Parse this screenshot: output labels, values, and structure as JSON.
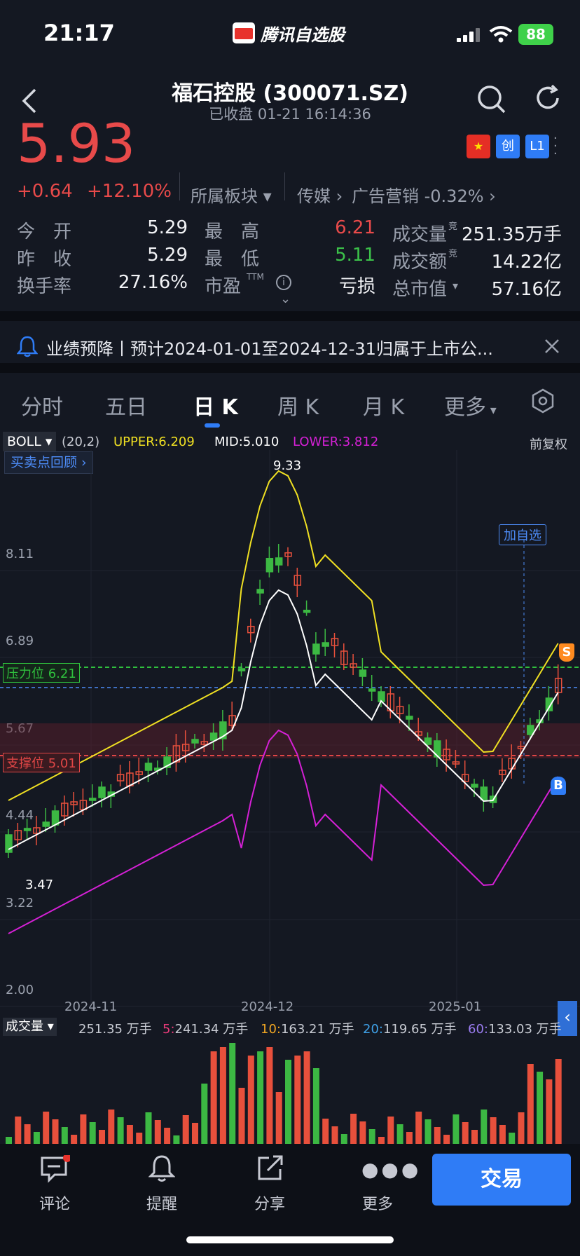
{
  "status_bar": {
    "time": "21:17",
    "app_name": "腾讯自选股",
    "battery": "88"
  },
  "header": {
    "title": "福石控股 (300071.SZ)",
    "subtitle": "已收盘  01-21 16:14:36"
  },
  "quote": {
    "price": "5.93",
    "change": "+0.64",
    "change_pct": "+12.10%",
    "sector_label": "所属板块",
    "sector_1": "传媒",
    "sector_2": "广告营销 -0.32%",
    "tag_chuang": "创",
    "tag_l1": "L1"
  },
  "stats": [
    {
      "label": "今　开",
      "value": "5.29",
      "label2": "最　高",
      "value2": "6.21",
      "label3": "成交量",
      "sup3": "竞",
      "value3": "251.35万手"
    },
    {
      "label": "昨　收",
      "value": "5.29",
      "label2": "最　低",
      "value2": "5.11",
      "label3": "成交额",
      "sup3": "竞",
      "value3": "14.22亿"
    },
    {
      "label": "换手率",
      "value": "27.16%",
      "label2": "市盈",
      "sup2": "TTM",
      "value2": "亏损",
      "label3": "总市值",
      "value3": "57.16亿"
    }
  ],
  "notice": {
    "text": "业绩预降丨预计2024-01-01至2024-12-31归属于上市公..."
  },
  "tabs": [
    "分时",
    "五日",
    "日 K",
    "周 K",
    "月 K",
    "更多"
  ],
  "indicator": {
    "name": "BOLL",
    "params": "(20,2)",
    "upper_label": "UPPER:",
    "upper": "6.209",
    "mid_label": "MID:",
    "mid": "5.010",
    "lower_label": "LOWER:",
    "lower": "3.812",
    "adjust": "前复权",
    "review_btn": "买卖点回顾"
  },
  "price_axis": [
    "8.11",
    "6.89",
    "5.67",
    "4.44",
    "3.22",
    "2.00"
  ],
  "marks": {
    "high_label": "9.33",
    "low_label": "3.47",
    "add_watch": "加自选",
    "resistance": "压力位 6.21",
    "support": "支撑位 5.01",
    "sell_marker": "S",
    "buy_marker": "B"
  },
  "date_axis": [
    "2024-11",
    "2024-12",
    "2025-01"
  ],
  "volume": {
    "label": "成交量",
    "total": "251.35 万手",
    "ma5_key": "5:",
    "ma5": "241.34 万手",
    "ma10_key": "10:",
    "ma10": "163.21 万手",
    "ma20_key": "20:",
    "ma20": "119.65 万手",
    "ma60_key": "60:",
    "ma60": "133.03 万手"
  },
  "colors": {
    "up": "#e8503c",
    "down": "#3cb843",
    "upper": "#f0e022",
    "mid": "#ffffff",
    "lower": "#d520d6",
    "accent": "#2f7cf6"
  },
  "nav": [
    "评论",
    "提醒",
    "分享",
    "更多"
  ],
  "trade": "交易"
}
